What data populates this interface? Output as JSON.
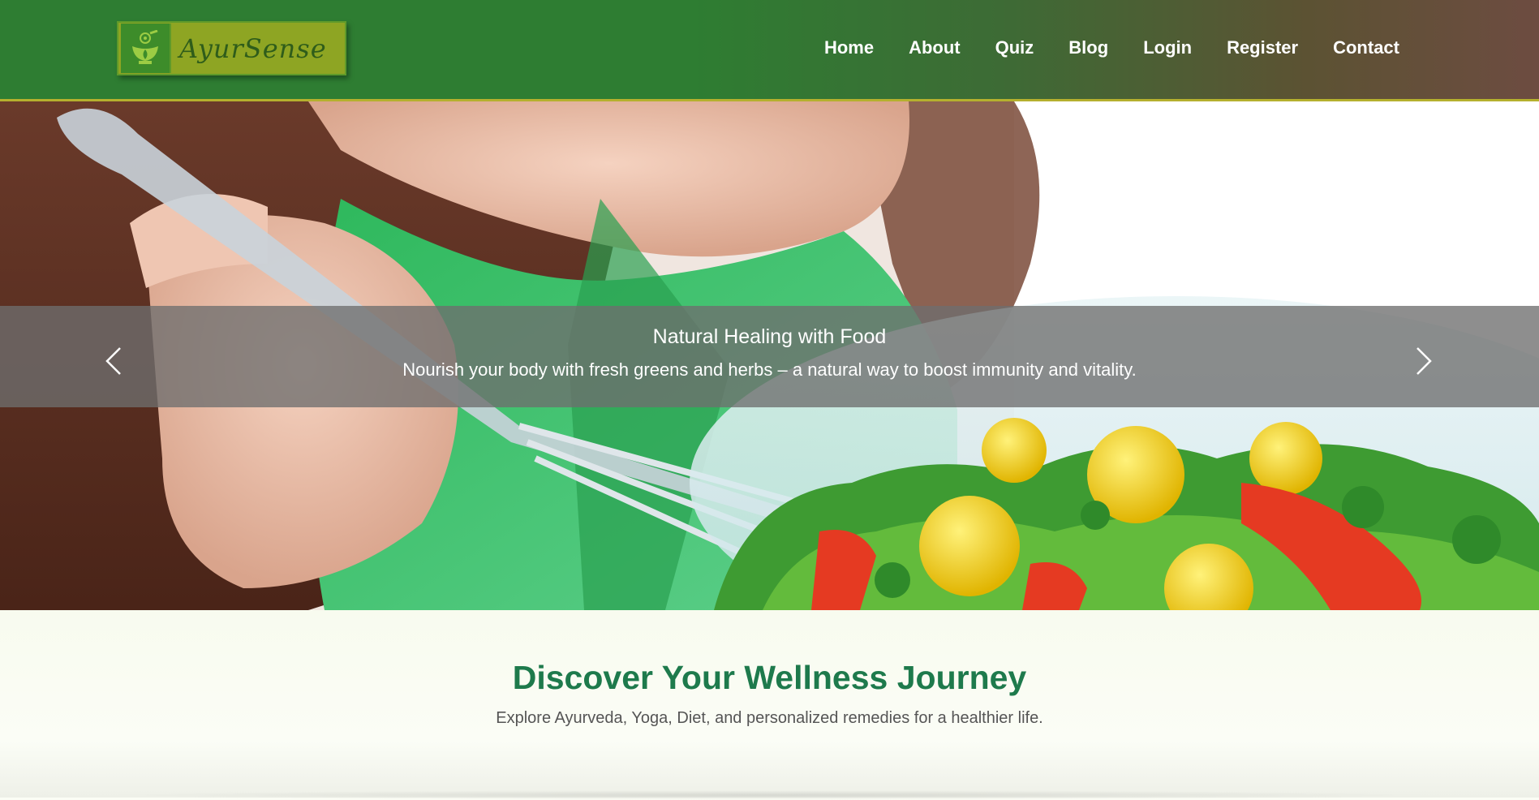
{
  "brand": {
    "name": "AyurSense",
    "logo_icon": "mortar-pestle-leaf-icon",
    "colors": {
      "header_green": "#2e7d32",
      "header_brown": "#6d4c41",
      "logo_bg": "#8ea523",
      "accent_line": "#b5b02e"
    }
  },
  "nav": {
    "items": [
      {
        "label": "Home"
      },
      {
        "label": "About"
      },
      {
        "label": "Quiz"
      },
      {
        "label": "Blog"
      },
      {
        "label": "Login"
      },
      {
        "label": "Register"
      },
      {
        "label": "Contact"
      }
    ]
  },
  "carousel": {
    "image": "woman-eating-salad",
    "slide": {
      "title": "Natural Healing with Food",
      "text": "Nourish your body with fresh greens and herbs – a natural way to boost immunity and vitality."
    },
    "prev_icon": "chevron-left-icon",
    "next_icon": "chevron-right-icon"
  },
  "wellness": {
    "heading": "Discover Your Wellness Journey",
    "subheading": "Explore Ayurveda, Yoga, Diet, and personalized remedies for a healthier life.",
    "heading_color": "#1e7a4c"
  }
}
